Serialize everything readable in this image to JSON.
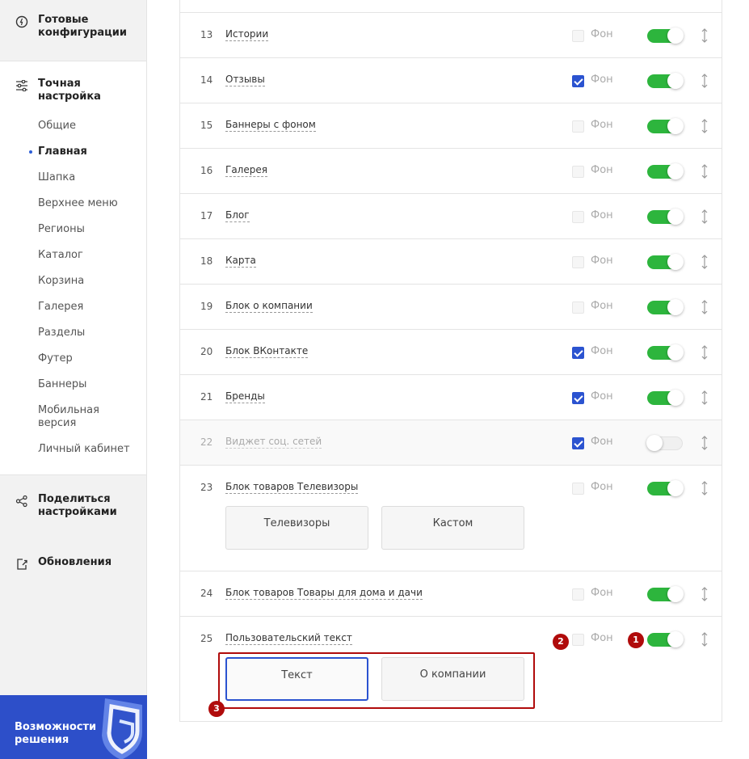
{
  "sidebar": {
    "ready_configs": "Готовые конфигурации",
    "fine_tuning": "Точная настройка",
    "items": [
      "Общие",
      "Главная",
      "Шапка",
      "Верхнее меню",
      "Регионы",
      "Каталог",
      "Корзина",
      "Галерея",
      "Разделы",
      "Футер",
      "Баннеры",
      "Мобильная версия",
      "Личный кабинет"
    ],
    "active_item": "Главная",
    "share": "Поделиться настройками",
    "updates": "Обновления",
    "promo": "Возможности решения"
  },
  "list": {
    "background_label": "Фон",
    "rows": [
      {
        "num": "13",
        "title": "Истории",
        "bg": false,
        "enabled": true
      },
      {
        "num": "14",
        "title": "Отзывы",
        "bg": true,
        "enabled": true
      },
      {
        "num": "15",
        "title": "Баннеры с фоном",
        "bg": false,
        "enabled": true
      },
      {
        "num": "16",
        "title": "Галерея",
        "bg": false,
        "enabled": true
      },
      {
        "num": "17",
        "title": "Блог",
        "bg": false,
        "enabled": true
      },
      {
        "num": "18",
        "title": "Карта",
        "bg": false,
        "enabled": true
      },
      {
        "num": "19",
        "title": "Блок о компании",
        "bg": false,
        "enabled": true
      },
      {
        "num": "20",
        "title": "Блок ВКонтакте",
        "bg": true,
        "enabled": true
      },
      {
        "num": "21",
        "title": "Бренды",
        "bg": true,
        "enabled": true
      },
      {
        "num": "22",
        "title": "Виджет соц. сетей",
        "bg": true,
        "enabled": false
      },
      {
        "num": "23",
        "title": "Блок товаров Телевизоры",
        "bg": false,
        "enabled": true,
        "options": [
          "Телевизоры",
          "Кастом"
        ]
      },
      {
        "num": "24",
        "title": "Блок товаров Товары для дома и дачи",
        "bg": false,
        "enabled": true
      },
      {
        "num": "25",
        "title": "Пользовательский текст",
        "bg": false,
        "enabled": true,
        "options": [
          "Текст",
          "О компании"
        ],
        "selected_option": "Текст"
      }
    ]
  },
  "annotations": {
    "badge_1": "1",
    "badge_2": "2",
    "badge_3": "3",
    "highlight_color": "#b00b0b"
  },
  "colors": {
    "toggle_on": "#2db53d",
    "checkbox_on": "#2b53d0",
    "promo_bg": "#2d4fc9"
  }
}
